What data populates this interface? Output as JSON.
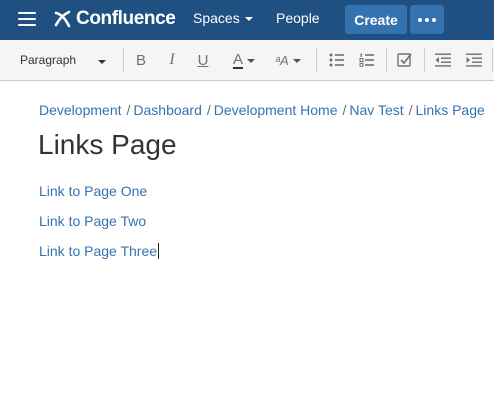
{
  "header": {
    "logo_text": "Confluence",
    "spaces_label": "Spaces",
    "people_label": "People",
    "create_label": "Create",
    "colors": {
      "bar": "#205081",
      "button": "#3572b0"
    }
  },
  "toolbar": {
    "paragraph_label": "Paragraph",
    "buttons": [
      {
        "name": "bold",
        "label": "B"
      },
      {
        "name": "italic",
        "label": "I"
      },
      {
        "name": "underline",
        "label": "U"
      },
      {
        "name": "text-color",
        "label": "A"
      },
      {
        "name": "text-format",
        "label": "ᵃA"
      }
    ]
  },
  "breadcrumbs": [
    "Development",
    "Dashboard",
    "Development Home",
    "Nav Test",
    "Links Page"
  ],
  "page": {
    "title": "Links Page",
    "links": [
      "Link to Page One",
      "Link to Page Two",
      "Link to Page Three"
    ]
  }
}
